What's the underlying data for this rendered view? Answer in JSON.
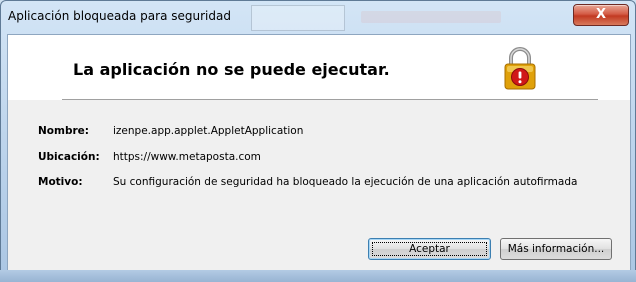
{
  "window": {
    "title": "Aplicación bloqueada para seguridad",
    "close_glyph": "X"
  },
  "header": {
    "message": "La aplicación no se puede ejecutar.",
    "icon": "warning-lock-icon"
  },
  "details": [
    {
      "label": "Nombre:",
      "value": "izenpe.app.applet.AppletApplication"
    },
    {
      "label": "Ubicación:",
      "value": "https://www.metaposta.com"
    },
    {
      "label": "Motivo:",
      "value": "Su configuración de seguridad ha bloqueado la ejecución de una aplicación autofirmada"
    }
  ],
  "buttons": {
    "accept": "Aceptar",
    "more_info": "Más información..."
  },
  "colors": {
    "close_red": "#c23a22",
    "lock_gold": "#e0a10a",
    "alert_red": "#d01818"
  }
}
